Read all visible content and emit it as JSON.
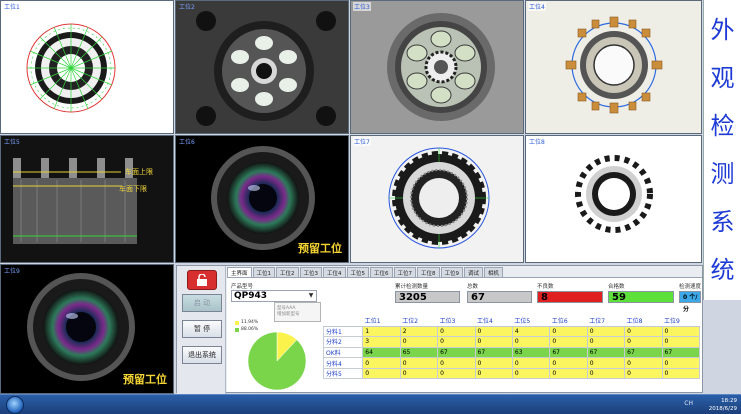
{
  "tiles": [
    {
      "id": 1,
      "label": "工位1"
    },
    {
      "id": 2,
      "label": "工位2"
    },
    {
      "id": 3,
      "label": "工位3"
    },
    {
      "id": 4,
      "label": "工位4"
    },
    {
      "id": 5,
      "label": "工位5",
      "annotations": [
        "车面上限",
        "车面下限"
      ]
    },
    {
      "id": 6,
      "label": "工位6",
      "reserve": "预留工位"
    },
    {
      "id": 7,
      "label": "工位7"
    },
    {
      "id": 8,
      "label": "工位8"
    },
    {
      "id": 9,
      "label": "工位9",
      "reserve": "预留工位"
    }
  ],
  "vertical_title": [
    "外",
    "观",
    "检",
    "测",
    "系",
    "统"
  ],
  "controls": {
    "start": "启 动",
    "pause": "暂 停",
    "exit": "退出系统"
  },
  "tabs": [
    "主界面",
    "工位1",
    "工位2",
    "工位3",
    "工位4",
    "工位5",
    "工位6",
    "工位7",
    "工位8",
    "工位9",
    "调试",
    "相机"
  ],
  "product": {
    "label": "产品型号",
    "value": "QP943",
    "dropdown_items": [
      "型号AAA",
      "增加新型号"
    ]
  },
  "legend": [
    {
      "text": "11.94%",
      "color": "#fbf24b"
    },
    {
      "text": "88.06%",
      "color": "#7ad54a"
    }
  ],
  "pie": {
    "slices": [
      {
        "value": 11.94,
        "color": "#fbf24b"
      },
      {
        "value": 88.06,
        "color": "#7ad54a"
      }
    ]
  },
  "stats": [
    {
      "label": "累计检测数量",
      "value": "3205",
      "color": "#c8c8c8"
    },
    {
      "label": "总数",
      "value": "67",
      "color": "#c8c8c8"
    },
    {
      "label": "不良数",
      "value": "8",
      "color": "#e02020"
    },
    {
      "label": "合格数",
      "value": "59",
      "color": "#5ee03a"
    },
    {
      "label": "检测速度",
      "value": "0 个/分",
      "color": "#3ca8e8"
    }
  ],
  "table": {
    "columns": [
      "",
      "工位1",
      "工位2",
      "工位3",
      "工位4",
      "工位5",
      "工位6",
      "工位7",
      "工位8",
      "工位9"
    ],
    "rows": [
      {
        "name": "分料1",
        "style": "y",
        "values": [
          "1",
          "2",
          "0",
          "0",
          "4",
          "0",
          "0",
          "0",
          "0"
        ]
      },
      {
        "name": "分料2",
        "style": "y",
        "values": [
          "3",
          "0",
          "0",
          "0",
          "0",
          "0",
          "0",
          "0",
          "0"
        ]
      },
      {
        "name": "OK料",
        "style": "g",
        "values": [
          "64",
          "65",
          "67",
          "67",
          "63",
          "67",
          "67",
          "67",
          "67"
        ]
      },
      {
        "name": "分料4",
        "style": "y",
        "values": [
          "0",
          "0",
          "0",
          "0",
          "0",
          "0",
          "0",
          "0",
          "0"
        ]
      },
      {
        "name": "分料5",
        "style": "y",
        "values": [
          "0",
          "0",
          "0",
          "0",
          "0",
          "0",
          "0",
          "0",
          "0"
        ]
      }
    ]
  },
  "taskbar": {
    "lang": "CH",
    "time": "18:29",
    "date": "2018/6/29"
  }
}
